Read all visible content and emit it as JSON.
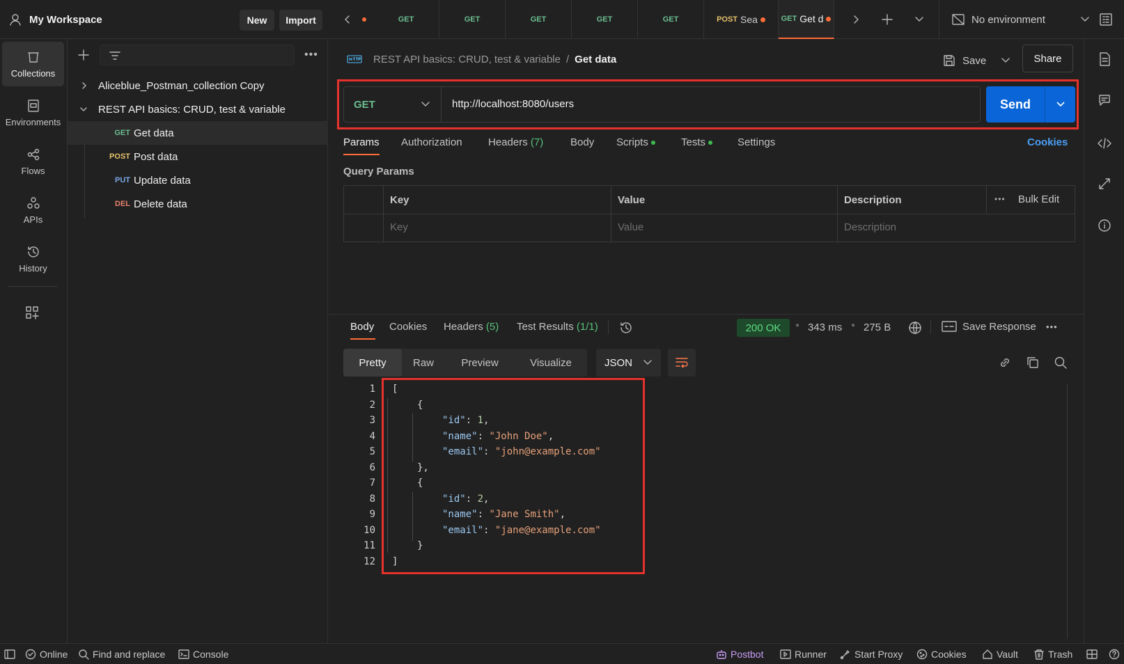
{
  "topbar": {
    "workspace": "My Workspace",
    "new_label": "New",
    "import_label": "Import",
    "tabs": [
      {
        "method": "GET",
        "label": ""
      },
      {
        "method": "GET",
        "label": ""
      },
      {
        "method": "GET",
        "label": ""
      },
      {
        "method": "GET",
        "label": ""
      },
      {
        "method": "GET",
        "label": ""
      },
      {
        "method": "POST",
        "label": "Sea"
      },
      {
        "method": "GET",
        "label": "Get d"
      }
    ],
    "environment": "No environment"
  },
  "rail": {
    "collections": "Collections",
    "environments": "Environments",
    "flows": "Flows",
    "apis": "APIs",
    "history": "History"
  },
  "sidebar": {
    "items": [
      {
        "label": "Aliceblue_Postman_collection Copy"
      },
      {
        "label": "REST API basics: CRUD, test & variable"
      }
    ],
    "requests": [
      {
        "method": "GET",
        "label": "Get data"
      },
      {
        "method": "POST",
        "label": "Post data"
      },
      {
        "method": "PUT",
        "label": "Update data"
      },
      {
        "method": "DEL",
        "label": "Delete data"
      }
    ]
  },
  "request": {
    "breadcrumb_parent": "REST API basics: CRUD, test & variable",
    "breadcrumb_sep": "/",
    "title": "Get data",
    "save_label": "Save",
    "share_label": "Share",
    "method": "GET",
    "url": "http://localhost:8080/users",
    "send_label": "Send",
    "tabs": {
      "params": "Params",
      "authorization": "Authorization",
      "headers": "Headers",
      "headers_count": "(7)",
      "body": "Body",
      "scripts": "Scripts",
      "tests": "Tests",
      "settings": "Settings",
      "cookies": "Cookies"
    },
    "query_params_title": "Query Params",
    "table": {
      "key_header": "Key",
      "value_header": "Value",
      "desc_header": "Description",
      "bulk_edit": "Bulk Edit",
      "key_placeholder": "Key",
      "value_placeholder": "Value",
      "desc_placeholder": "Description"
    }
  },
  "response": {
    "tabs": {
      "body": "Body",
      "cookies": "Cookies",
      "headers": "Headers",
      "headers_count": "(5)",
      "tests": "Test Results",
      "tests_count": "(1/1)"
    },
    "status": "200 OK",
    "time": "343 ms",
    "size": "275 B",
    "save_response": "Save Response",
    "views": {
      "pretty": "Pretty",
      "raw": "Raw",
      "preview": "Preview",
      "visualize": "Visualize"
    },
    "format": "JSON",
    "line_numbers": [
      "1",
      "2",
      "3",
      "4",
      "5",
      "6",
      "7",
      "8",
      "9",
      "10",
      "11",
      "12"
    ],
    "records": [
      {
        "id": "1",
        "name": "\"John Doe\"",
        "email": "\"john@example.com\""
      },
      {
        "id": "2",
        "name": "\"Jane Smith\"",
        "email": "\"jane@example.com\""
      }
    ]
  },
  "bottombar": {
    "online": "Online",
    "find_replace": "Find and replace",
    "console": "Console",
    "postbot": "Postbot",
    "runner": "Runner",
    "start_proxy": "Start Proxy",
    "cookies": "Cookies",
    "vault": "Vault",
    "trash": "Trash"
  },
  "colors": {
    "send_button": "#0a66d8",
    "highlight_border": "#e5322d",
    "status_ok_bg": "#1e4a2b",
    "accent_orange": "#ff6c37"
  }
}
